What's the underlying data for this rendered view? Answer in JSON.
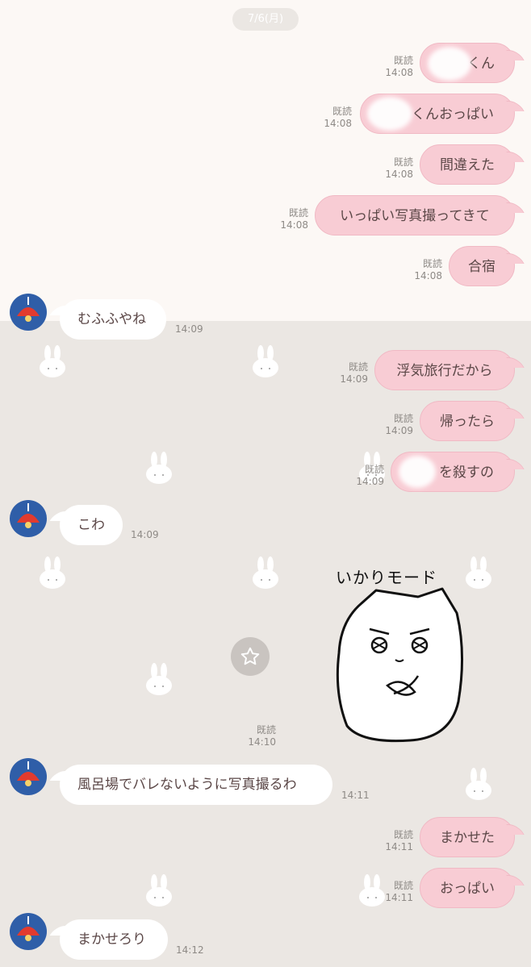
{
  "date_label": "7/6(月)",
  "read_label": "既読",
  "sticker_caption": "いかりモード",
  "messages": [
    {
      "dir": "out",
      "text": "くん",
      "time": "14:08",
      "read": true
    },
    {
      "dir": "out",
      "text": "くんおっぱい",
      "time": "14:08",
      "read": true
    },
    {
      "dir": "out",
      "text": "間違えた",
      "time": "14:08",
      "read": true
    },
    {
      "dir": "out",
      "text": "いっぱい写真撮ってきて",
      "time": "14:08",
      "read": true
    },
    {
      "dir": "out",
      "text": "合宿",
      "time": "14:08",
      "read": true
    },
    {
      "dir": "in",
      "text": "むふふやね",
      "time": "14:09"
    },
    {
      "dir": "out",
      "text": "浮気旅行だから",
      "time": "14:09",
      "read": true
    },
    {
      "dir": "out",
      "text": "帰ったら",
      "time": "14:09",
      "read": true
    },
    {
      "dir": "out",
      "text": "を殺すの",
      "time": "14:09",
      "read": true
    },
    {
      "dir": "in",
      "text": "こわ",
      "time": "14:09"
    },
    {
      "dir": "out",
      "type": "sticker",
      "time": "14:10",
      "read": true
    },
    {
      "dir": "in",
      "text": "風呂場でバレないように写真撮るわ",
      "time": "14:11"
    },
    {
      "dir": "out",
      "text": "まかせた",
      "time": "14:11",
      "read": true
    },
    {
      "dir": "out",
      "text": "おっぱい",
      "time": "14:11",
      "read": true
    },
    {
      "dir": "in",
      "text": "まかせろり",
      "time": "14:12"
    }
  ],
  "colors": {
    "outgoing_bubble": "#f8ccd4",
    "incoming_bubble": "#ffffff",
    "avatar": "#2f5ea8",
    "background_top": "#fcf8f5",
    "background_bottom": "#ebe7e3"
  }
}
